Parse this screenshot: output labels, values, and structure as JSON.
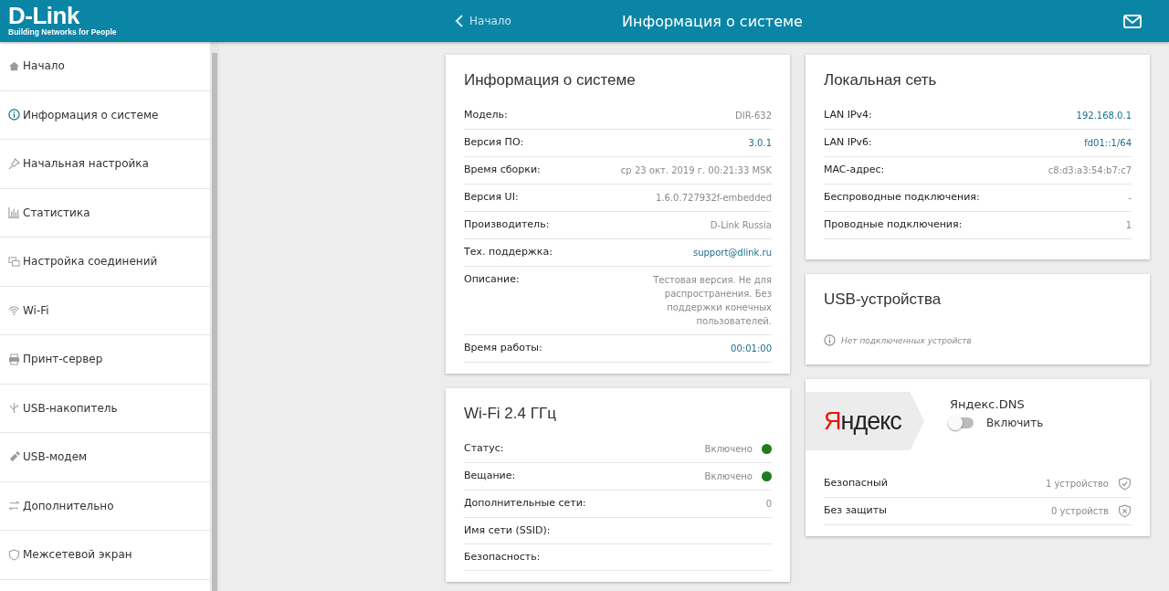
{
  "logo": {
    "brand": "D-Link",
    "tagline": "Building Networks for People"
  },
  "header": {
    "back": "Начало",
    "title": "Информация о системе"
  },
  "sidebar": {
    "items": [
      {
        "label": "Начало",
        "kind": "home"
      },
      {
        "label": "Информация о системе",
        "kind": "info"
      },
      {
        "label": "Начальная настройка",
        "kind": "pin"
      },
      {
        "label": "Статистика",
        "kind": "stats"
      },
      {
        "label": "Настройка соединений",
        "kind": "screens"
      },
      {
        "label": "Wi-Fi",
        "kind": "wifi"
      },
      {
        "label": "Принт-сервер",
        "kind": "printer"
      },
      {
        "label": "USB-накопитель",
        "kind": "usb"
      },
      {
        "label": "USB-модем",
        "kind": "modem"
      },
      {
        "label": "Дополнительно",
        "kind": "arrows"
      },
      {
        "label": "Межсетевой экран",
        "kind": "shield"
      }
    ]
  },
  "system": {
    "title": "Информация о системе",
    "rows": [
      {
        "label": "Модель:",
        "value": "DIR-632",
        "link": false
      },
      {
        "label": "Версия ПО:",
        "value": "3.0.1",
        "link": true
      },
      {
        "label": "Время сборки:",
        "value": "ср 23 окт. 2019 г. 00:21:33 MSK",
        "link": false
      },
      {
        "label": "Версия UI:",
        "value": "1.6.0.727932f-embedded",
        "link": false
      },
      {
        "label": "Производитель:",
        "value": "D-Link Russia",
        "link": false
      },
      {
        "label": "Тех. поддержка:",
        "value": "support@dlink.ru",
        "link": true
      },
      {
        "label": "Описание:",
        "value": "Тестовая версия. Не для распространения. Без поддержки конечных пользователей.",
        "link": false
      },
      {
        "label": "Время работы:",
        "value": "00:01:00",
        "link": true
      }
    ]
  },
  "wifi": {
    "title": "Wi-Fi 2.4 ГГц",
    "rows": [
      {
        "label": "Статус:",
        "value": "Включено",
        "color": "#1e7d1e"
      },
      {
        "label": "Вещание:",
        "value": "Включено",
        "color": "#1e7d1e"
      },
      {
        "label": "Дополнительные сети:",
        "value": "0"
      },
      {
        "label": "Имя сети (SSID):"
      },
      {
        "label": "Безопасность:"
      }
    ]
  },
  "lan": {
    "title": "Локальная сеть",
    "rows": [
      {
        "label": "LAN IPv4:",
        "value": "192.168.0.1",
        "link": true
      },
      {
        "label": "LAN IPv6:",
        "value": "fd01::1/64",
        "link": true
      },
      {
        "label": "MAC-адрес:",
        "value": "c8:d3:a3:54:b7:c7",
        "link": false
      },
      {
        "label": "Беспроводные подключения:",
        "value": "-",
        "link": false
      },
      {
        "label": "Проводные подключения:",
        "value": "1",
        "link": false
      }
    ]
  },
  "usb": {
    "title": "USB-устройства",
    "message": "Нет подключенных устройств"
  },
  "yandex": {
    "logo": "Яндекс",
    "title": "Яндекс.DNS",
    "toggle": {
      "label": "Включить",
      "on": false
    },
    "rows": [
      {
        "label": "Безопасный",
        "value": "1 устройство",
        "kind": "protected"
      },
      {
        "label": "Без защиты",
        "value": "0 устройств",
        "kind": "unprotected"
      }
    ]
  }
}
